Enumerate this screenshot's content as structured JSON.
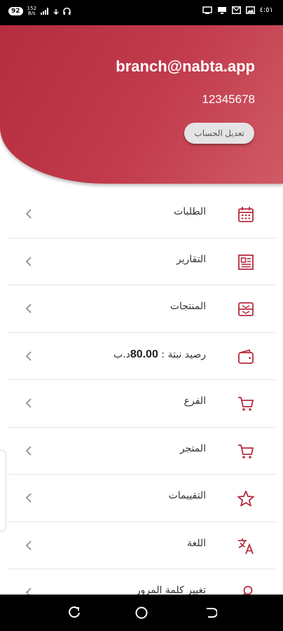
{
  "status_bar": {
    "badge": "92",
    "net_speed_top": "152",
    "net_speed_bottom": "B/s",
    "time": "٤:٥١",
    "icons": [
      "signal-icon",
      "wifi-icon",
      "headset-icon",
      "cast-icon",
      "tv-icon",
      "mail-icon",
      "image-icon"
    ]
  },
  "header": {
    "email": "branch@nabta.app",
    "phone": "12345678",
    "edit_button": "تعديل الحساب"
  },
  "menu": {
    "items": [
      {
        "label": "الطلبات",
        "icon": "calendar-icon"
      },
      {
        "label": "التقارير",
        "icon": "report-icon"
      },
      {
        "label": "المنتجات",
        "icon": "inbox-icon"
      },
      {
        "label": "رصيد نبتة : ",
        "amount": "80.00",
        "currency": "د.ب",
        "icon": "wallet-icon"
      },
      {
        "label": "الفرع",
        "icon": "cart-icon"
      },
      {
        "label": "المتجر",
        "icon": "cart-icon"
      },
      {
        "label": "التقييمات",
        "icon": "star-icon"
      },
      {
        "label": "اللغة",
        "icon": "translate-icon"
      },
      {
        "label": "تغيير كلمة المرور",
        "icon": "key-icon"
      }
    ]
  },
  "colors": {
    "accent": "#b52c3f",
    "icon": "#b52c3f",
    "chevron": "#9a9a9a"
  },
  "nav_bar": {
    "buttons": [
      "recent-apps-icon",
      "home-icon",
      "back-icon"
    ]
  }
}
